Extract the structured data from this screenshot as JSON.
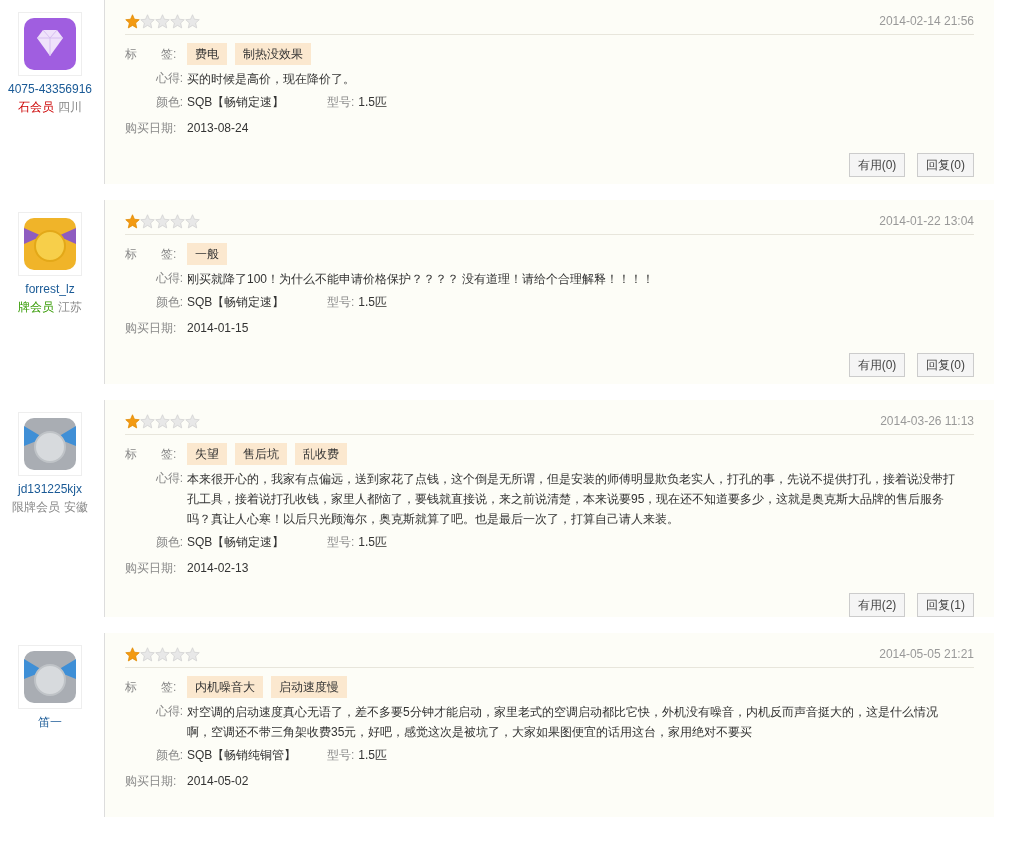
{
  "reviews": [
    {
      "user": {
        "name": "4075-43356916",
        "level": "石会员",
        "region": "四川",
        "avatar": {
          "kind": "diamond"
        }
      },
      "stars": 1,
      "date": "2014-02-14 21:56",
      "tags_label": "标　　签:",
      "tags": [
        "费电",
        "制热没效果"
      ],
      "comment_label": "心得:",
      "comment": "买的时候是高价，现在降价了。",
      "color_label": "颜色:",
      "product_color": "SQB【畅销定速】",
      "model_label": "型号:",
      "model": "1.5匹",
      "date_label": "购买日期:",
      "purchase_date": "2013-08-24",
      "buttons": [
        "有用(0)",
        "回复(0)"
      ]
    },
    {
      "user": {
        "name": "forrest_lz",
        "level": "牌会员",
        "region": "江苏",
        "avatar": {
          "kind": "gold"
        }
      },
      "stars": 1,
      "date": "2014-01-22 13:04",
      "tags_label": "标　　签:",
      "tags": [
        "一般"
      ],
      "comment_label": "心得:",
      "comment": "刚买就降了100！为什么不能申请价格保护？？？？ 没有道理！请给个合理解释！！！！",
      "color_label": "颜色:",
      "product_color": "SQB【畅销定速】",
      "model_label": "型号:",
      "model": "1.5匹",
      "date_label": "购买日期:",
      "purchase_date": "2014-01-15",
      "buttons": [
        "有用(0)",
        "回复(0)"
      ]
    },
    {
      "user": {
        "name": "jd131225kjx",
        "level": "限牌会员",
        "region": "安徽",
        "avatar": {
          "kind": "silver"
        }
      },
      "stars": 1,
      "date": "2014-03-26 11:13",
      "tags_label": "标　　签:",
      "tags": [
        "失望",
        "售后坑",
        "乱收费"
      ],
      "comment_label": "心得:",
      "comment": "本来很开心的，我家有点偏远，送到家花了点钱，这个倒是无所谓，但是安装的师傅明显欺负老实人，打孔的事，先说不提供打孔，接着说没带打孔工具，接着说打孔收钱，家里人都恼了，要钱就直接说，来之前说清楚，本来说要95，现在还不知道要多少，这就是奥克斯大品牌的售后服务吗？真让人心寒！以后只光顾海尔，奥克斯就算了吧。也是最后一次了，打算自己请人来装。",
      "color_label": "颜色:",
      "product_color": "SQB【畅销定速】",
      "model_label": "型号:",
      "model": "1.5匹",
      "date_label": "购买日期:",
      "purchase_date": "2014-02-13",
      "buttons": [
        "有用(2)",
        "回复(1)"
      ]
    },
    {
      "user": {
        "name": "笛一",
        "avatar": {
          "kind": "silver"
        }
      },
      "stars": 1,
      "date": "2014-05-05 21:21",
      "tags_label": "标　　签:",
      "tags": [
        "内机噪音大",
        "启动速度慢"
      ],
      "comment_label": "心得:",
      "comment": "对空调的启动速度真心无语了，差不多要5分钟才能启动，家里老式的空调启动都比它快，外机没有噪音，内机反而声音挺大的，这是什么情况啊，空调还不带三角架收费35元，好吧，感觉这次是被坑了，大家如果图便宜的话用这台，家用绝对不要买",
      "color_label": "颜色:",
      "product_color": "SQB【畅销纯铜管】",
      "model_label": "型号:",
      "model": "1.5匹",
      "date_label": "购买日期:",
      "purchase_date": "2014-05-02"
    }
  ]
}
